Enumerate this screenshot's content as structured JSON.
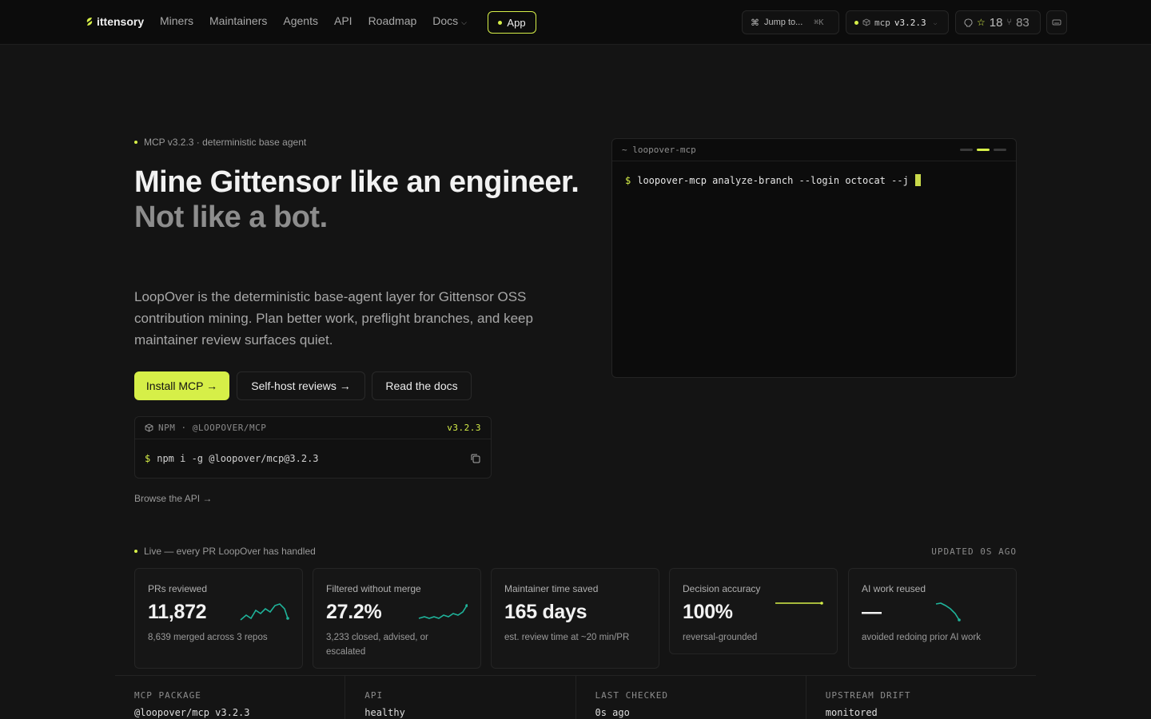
{
  "nav": {
    "logo": "ittensory",
    "links": [
      "Miners",
      "Maintainers",
      "Agents",
      "API",
      "Roadmap",
      "Docs"
    ],
    "app_button": "App",
    "jump": "Jump to...",
    "jump_kbd": "⌘K",
    "mcp_label": "mcp",
    "mcp_version": "v3.2.3",
    "stars": "18",
    "forks": "83"
  },
  "hero": {
    "eyebrow": "MCP v3.2.3 · deterministic base agent",
    "title_line1": "Mine Gittensor like an engineer.",
    "title_line2": "Not like a bot.",
    "lede": "LoopOver is the deterministic base-agent layer for Gittensor OSS contribution mining. Plan better work, preflight branches, and keep maintainer review surfaces quiet.",
    "btn_install": "Install MCP →",
    "btn_selfhost": "Self-host reviews →",
    "btn_docs": "Read the docs",
    "npm_label": "NPM · @LOOPOVER/MCP",
    "npm_version": "v3.2.3",
    "npm_prompt": "$",
    "npm_cmd": "npm i -g @loopover/mcp@3.2.3",
    "browse": "Browse the API →"
  },
  "terminal": {
    "title": "~ loopover-mcp",
    "prompt": "$",
    "command": "loopover-mcp analyze-branch --login octocat --j"
  },
  "live": {
    "label": "Live — every PR LoopOver has handled",
    "updated": "UPDATED 0S AGO",
    "stats": [
      {
        "label": "PRs reviewed",
        "value": "11,872",
        "note": "8,639 merged across 3 repos"
      },
      {
        "label": "Filtered without merge",
        "value": "27.2%",
        "note": "3,233 closed, advised, or escalated"
      },
      {
        "label": "Maintainer time saved",
        "value": "165 days",
        "note": "est. review time at ~20 min/PR"
      },
      {
        "label": "Decision accuracy",
        "value": "100%",
        "note": "reversal-grounded"
      },
      {
        "label": "AI work reused",
        "value": "—",
        "note": "avoided redoing prior AI work"
      }
    ]
  },
  "status_bar": [
    {
      "label": "MCP PACKAGE",
      "value": "@loopover/mcp v3.2.3"
    },
    {
      "label": "API",
      "value": "healthy"
    },
    {
      "label": "LAST CHECKED",
      "value": "0s ago"
    },
    {
      "label": "UPSTREAM DRIFT",
      "value": "monitored"
    }
  ],
  "colors": {
    "accent": "#d6ef48",
    "teal": "#1fb39a",
    "bg": "#141414"
  }
}
